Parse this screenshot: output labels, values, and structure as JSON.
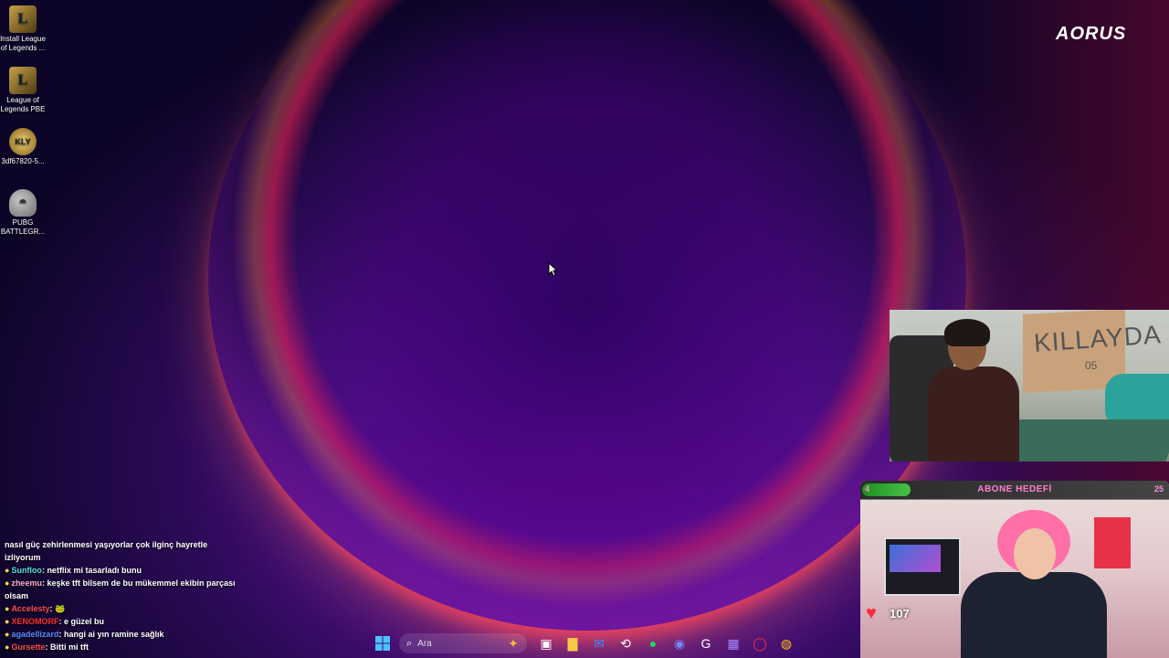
{
  "desktop": {
    "brand_logo": "AORUS",
    "icons": [
      {
        "label": "Install League of Legends ...",
        "icon": "league-of-legends-icon"
      },
      {
        "label": "League of Legends PBE",
        "icon": "league-of-legends-pbe-icon"
      },
      {
        "label": "3df67820-5...",
        "icon": "kly-badge-icon"
      },
      {
        "label": "PUBG BATTLEGR...",
        "icon": "pubg-helmet-icon"
      }
    ]
  },
  "webcam_top": {
    "box_text": "KILLAYDA",
    "box_subtext": "05"
  },
  "subscriber_goal": {
    "title": "ABONE HEDEFİ",
    "current": "4",
    "target": "25",
    "progress": 0.16
  },
  "stream_overlay": {
    "heart_count": "107"
  },
  "chat": {
    "messages": [
      {
        "user": "",
        "text": "nasıl güç zehirlenmesi yaşıyorlar çok ilginç hayretle izliyorum"
      },
      {
        "user": "Sunfloo",
        "text": "netflix mi tasarladı bunu"
      },
      {
        "user": "zheemu",
        "text": "keşke tft bilsem de bu mükemmel ekibin parçası olsam"
      },
      {
        "user": "Accelesty",
        "text": ""
      },
      {
        "user": "XENOMORF",
        "text": "e güzel bu"
      },
      {
        "user": "agadellizard",
        "text": "hangi ai yın ramine sağlık"
      },
      {
        "user": "Gursette",
        "text": "Bitti mi tft"
      }
    ]
  },
  "taskbar": {
    "search_placeholder": "Ara",
    "items": [
      "start-icon",
      "search-icon",
      "widget-icon",
      "task-view-icon",
      "file-explorer-icon",
      "outlook-icon",
      "app-icon",
      "spotify-icon",
      "discord-icon",
      "logitech-icon",
      "app-grid-icon",
      "opera-gx-icon",
      "chrome-icon"
    ]
  }
}
